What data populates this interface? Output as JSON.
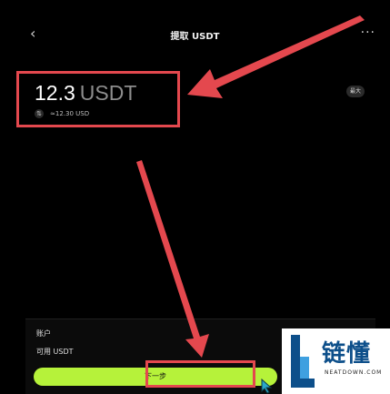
{
  "header": {
    "back_icon": "chevron-left-icon",
    "title": "提取 USDT",
    "more_icon": "more-horizontal-icon"
  },
  "amount": {
    "value": "12.3",
    "unit": "USDT",
    "approx": "≈12.30",
    "approx_unit": "USD",
    "swap_icon": "swap-icon",
    "max_label": "最大"
  },
  "bottom": {
    "account_label": "账户",
    "available_label": "可用 USDT",
    "next_label": "下一步"
  },
  "colors": {
    "accent": "#b6f23a",
    "annotation": "#e4484e",
    "background": "#000000"
  },
  "watermark": {
    "cn": "链懂",
    "en": "NEATDOWN.COM"
  }
}
